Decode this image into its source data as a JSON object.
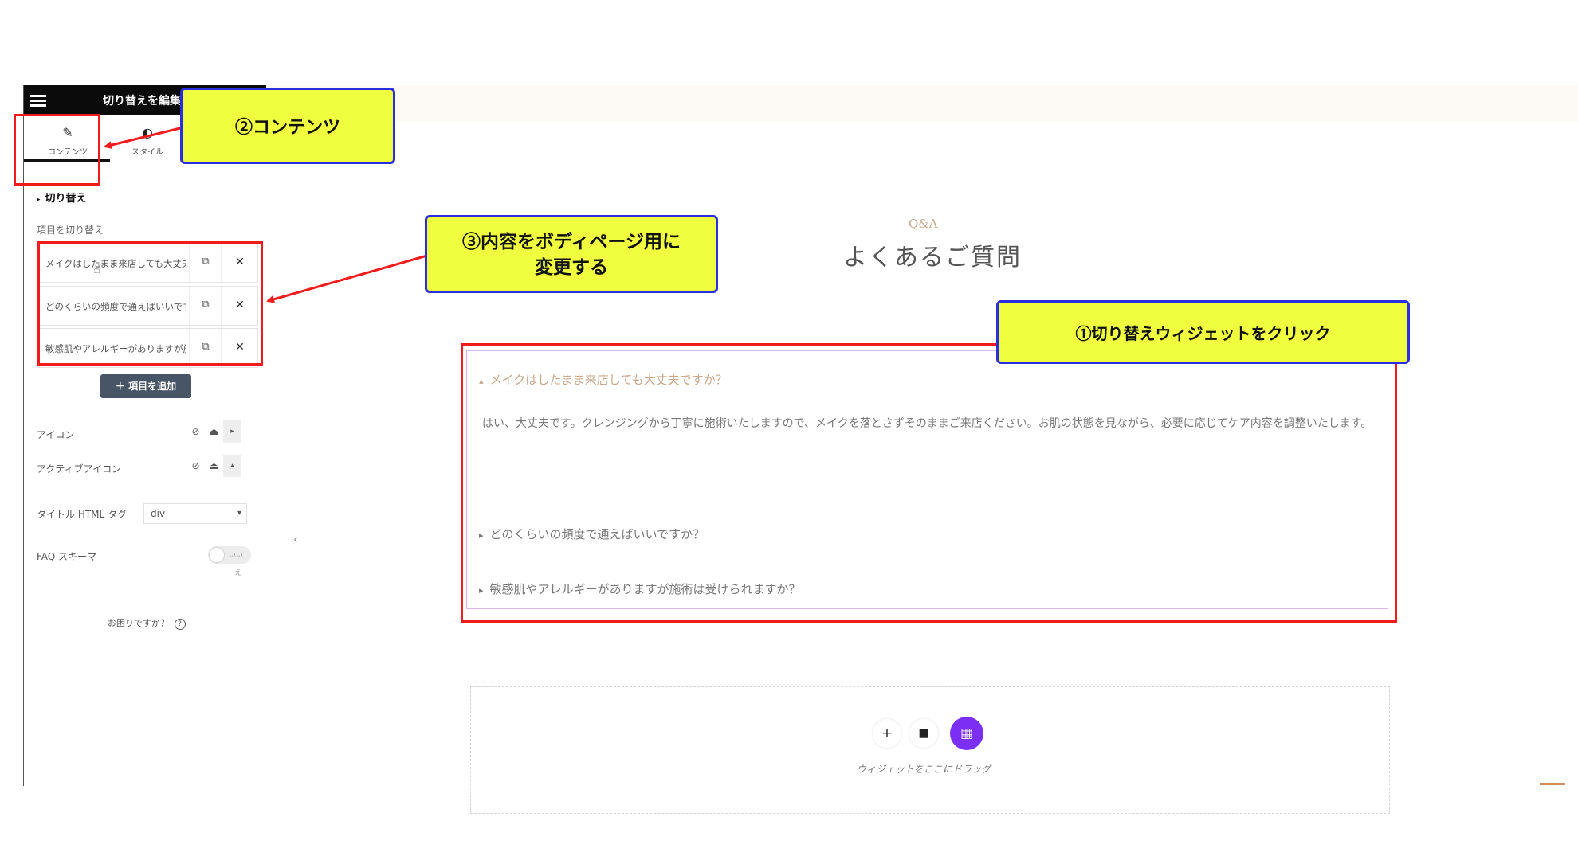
{
  "panel": {
    "title": "切り替えを編集",
    "tabs": [
      {
        "label": "コンテンツ",
        "icon": "pencil-icon"
      },
      {
        "label": "スタイル",
        "icon": "half-circle-icon"
      }
    ],
    "section_title": "切り替え",
    "items_label": "項目を切り替え",
    "items": [
      "メイクはしたまま来店しても大丈夫ですか？",
      "どのくらいの頻度で通えばいいですか？",
      "敏感肌やアレルギーがありますが施術は受けられますか？"
    ],
    "add_item_label": "＋ 項目を追加",
    "icon_label": "アイコン",
    "active_icon_label": "アクティブアイコン",
    "title_tag_label": "タイトル HTML タグ",
    "title_tag_value": "div",
    "faq_schema_label": "FAQ スキーマ",
    "faq_schema_value": "いい",
    "faq_schema_value_extra": "え",
    "help_text": "お困りですか？"
  },
  "preview": {
    "small_heading": "Q&A",
    "heading": "よくあるご質問",
    "accordion": [
      {
        "title": "メイクはしたまま来店しても大丈夫ですか？",
        "open": true,
        "content": "はい、大丈夫です。クレンジングから丁寧に施術いたしますので、メイクを落とさずそのままご来店ください。お肌の状態を見ながら、必要に応じてケア内容を調整いたします。"
      },
      {
        "title": "どのくらいの頻度で通えばいいですか？",
        "open": false
      },
      {
        "title": "敏感肌やアレルギーがありますが施術は受けられますか？",
        "open": false
      }
    ],
    "drop_text": "ウィジェットをここにドラッグ"
  },
  "annotations": {
    "step1": "①切り替えウィジェットをクリック",
    "step2": "②コンテンツ",
    "step3_line1": "③内容をボディページ用に",
    "step3_line2": "変更する"
  },
  "colors": {
    "annotation_red": "#ee1c1c",
    "callout_fill": "#efff3f",
    "callout_border": "#2b2ee0",
    "accent_gold": "#c8a78a",
    "kit_purple": "#7b2ff2"
  }
}
